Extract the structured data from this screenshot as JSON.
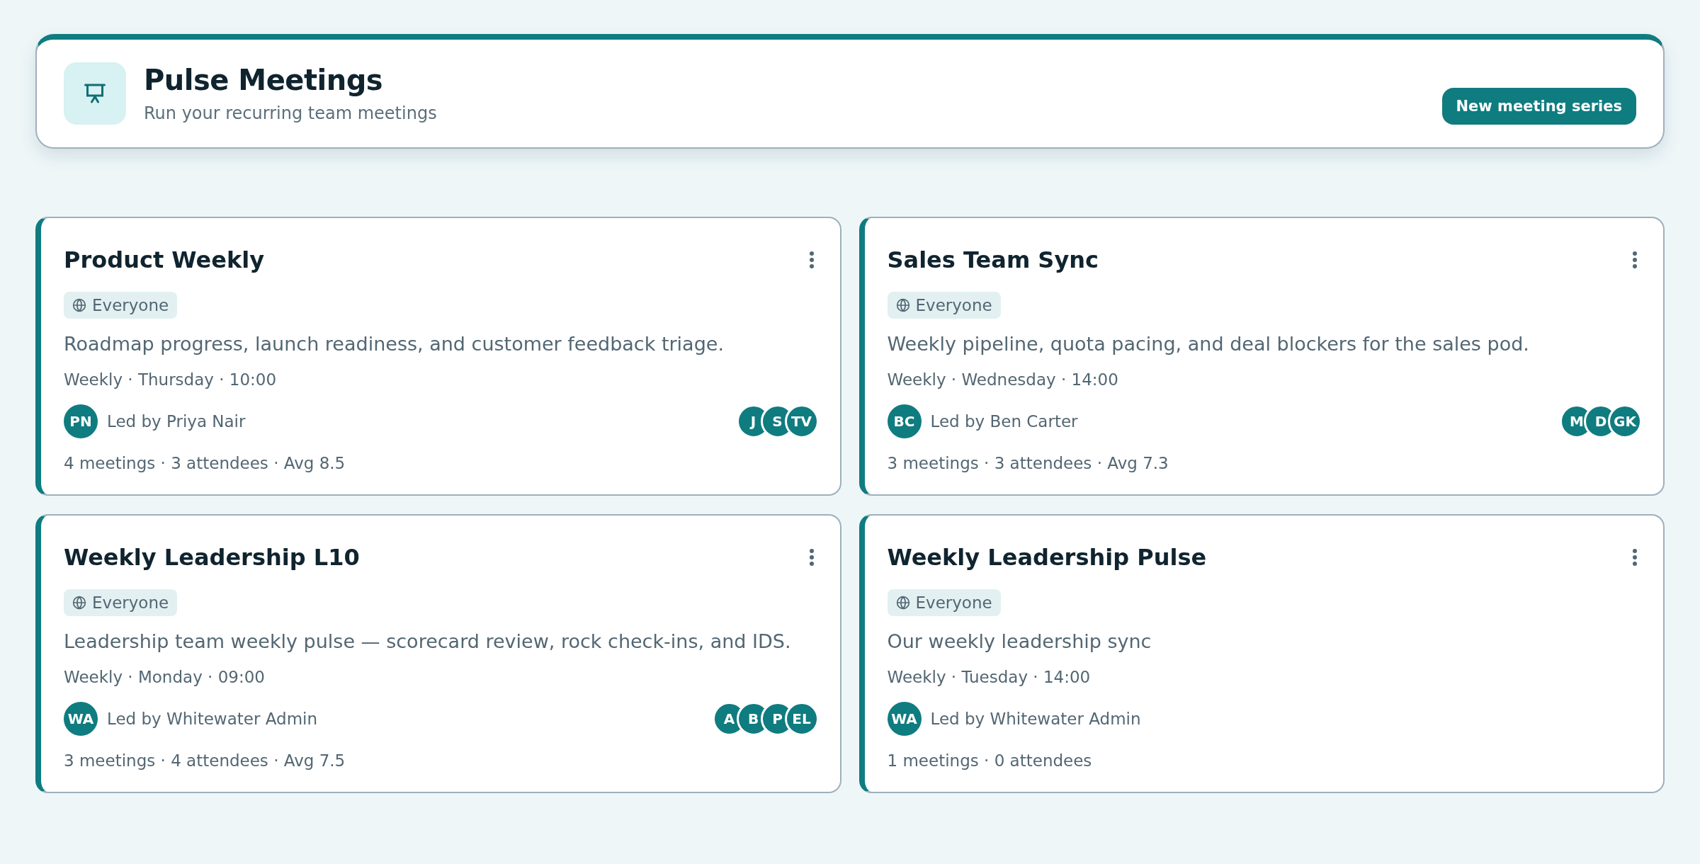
{
  "header": {
    "title": "Pulse Meetings",
    "subtitle": "Run your recurring team meetings",
    "button": "New meeting series"
  },
  "series": [
    {
      "title": "Product Weekly",
      "audience": "Everyone",
      "description": "Roadmap progress, launch readiness, and customer feedback triage.",
      "schedule": "Weekly · Thursday · 10:00",
      "leader_initials": "PN",
      "leader": "Led by Priya Nair",
      "attendees": [
        "J",
        "S",
        "TV"
      ],
      "stats": "4 meetings · 3 attendees · Avg 8.5"
    },
    {
      "title": "Sales Team Sync",
      "audience": "Everyone",
      "description": "Weekly pipeline, quota pacing, and deal blockers for the sales pod.",
      "schedule": "Weekly · Wednesday · 14:00",
      "leader_initials": "BC",
      "leader": "Led by Ben Carter",
      "attendees": [
        "M",
        "D",
        "GK"
      ],
      "stats": "3 meetings · 3 attendees · Avg 7.3"
    },
    {
      "title": "Weekly Leadership L10",
      "audience": "Everyone",
      "description": "Leadership team weekly pulse — scorecard review, rock check-ins, and IDS.",
      "schedule": "Weekly · Monday · 09:00",
      "leader_initials": "WA",
      "leader": "Led by Whitewater Admin",
      "attendees": [
        "A",
        "B",
        "P",
        "EL"
      ],
      "stats": "3 meetings · 4 attendees · Avg 7.5"
    },
    {
      "title": "Weekly Leadership Pulse",
      "audience": "Everyone",
      "description": "Our weekly leadership sync",
      "schedule": "Weekly · Tuesday · 14:00",
      "leader_initials": "WA",
      "leader": "Led by Whitewater Admin",
      "stats": "1 meetings · 0 attendees"
    }
  ]
}
